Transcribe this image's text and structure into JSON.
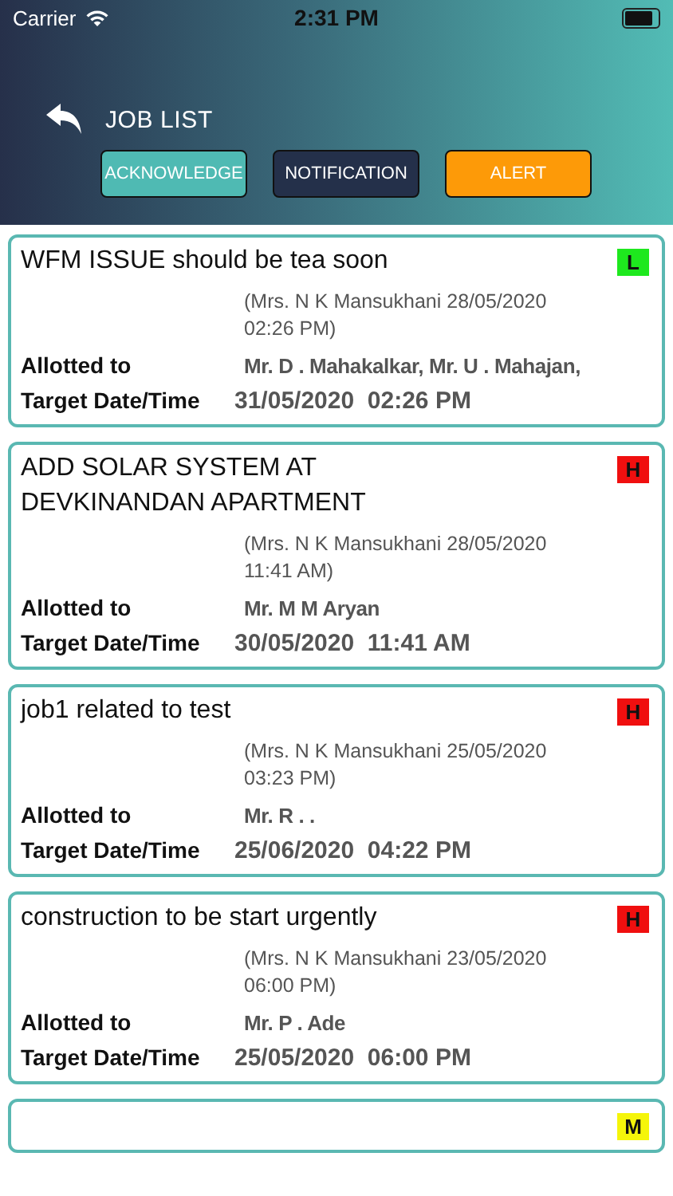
{
  "status_bar": {
    "carrier": "Carrier",
    "time": "2:31 PM"
  },
  "header": {
    "title": "JOB LIST"
  },
  "tabs": [
    {
      "label": "ACKNOWLEDGE",
      "color": "#4fbab3"
    },
    {
      "label": "NOTIFICATION",
      "color": "#24304a"
    },
    {
      "label": "ALERT",
      "color": "#fd9a08"
    }
  ],
  "jobs": [
    {
      "title": "WFM ISSUE should be tea soon",
      "priority": "L",
      "color": "#1ee81e",
      "created": "(Mrs. N K Mansukhani 28/05/2020 02:26 PM)",
      "allotted_label": "Allotted to",
      "allotted": "Mr. D . Mahakalkar, Mr. U . Mahajan,",
      "target_label": "Target Date/Time",
      "target": "31/05/2020  02:26 PM"
    },
    {
      "title": "ADD SOLAR SYSTEM AT DEVKINANDAN APARTMENT",
      "priority": "H",
      "color": "#f00f0f",
      "created": "(Mrs. N K Mansukhani 28/05/2020 11:41 AM)",
      "allotted_label": "Allotted to",
      "allotted": "Mr. M M Aryan",
      "target_label": "Target Date/Time",
      "target": "30/05/2020  11:41 AM"
    },
    {
      "title": "job1 related to test",
      "priority": "H",
      "color": "#f00f0f",
      "created": "(Mrs. N K Mansukhani 25/05/2020 03:23 PM)",
      "allotted_label": "Allotted to",
      "allotted": "Mr. R . .",
      "target_label": "Target Date/Time",
      "target": "25/06/2020  04:22 PM"
    },
    {
      "title": "construction to be start urgently",
      "priority": "H",
      "color": "#f00f0f",
      "created": "(Mrs. N K Mansukhani 23/05/2020 06:00 PM)",
      "allotted_label": "Allotted to",
      "allotted": "Mr. P . Ade",
      "target_label": "Target Date/Time",
      "target": "25/05/2020  06:00 PM"
    },
    {
      "priority": "M",
      "color": "#f5f50a"
    }
  ]
}
